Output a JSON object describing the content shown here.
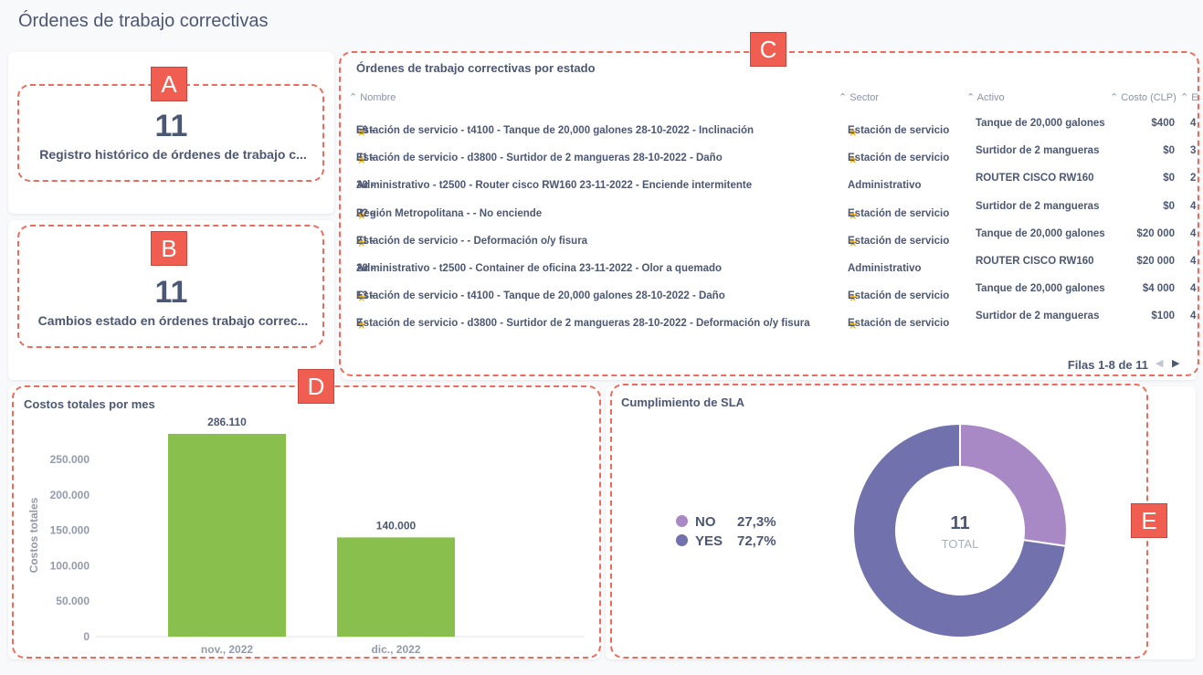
{
  "page_title": "Órdenes de trabajo correctivas",
  "callouts": [
    "A",
    "B",
    "C",
    "D",
    "E"
  ],
  "card_a": {
    "value": "11",
    "label": "Registro histórico de órdenes de trabajo c..."
  },
  "card_b": {
    "value": "11",
    "label": "Cambios estado en órdenes trabajo correc..."
  },
  "table": {
    "title": "Órdenes de trabajo correctivas por estado",
    "columns": [
      "Nombre",
      "Sector",
      "Activo",
      "Costo (CLP)",
      "E"
    ],
    "rows": [
      {
        "nombre_pre": "50 - ",
        "star": true,
        "nombre": "Estación de servicio - t4100 - Tanque de 20,000 galones 28-10-2022 - Inclinación",
        "sector_star": true,
        "sector": "Estación de servicio",
        "activo": "Tanque de 20,000 galones",
        "costo": "$400",
        "e": "4"
      },
      {
        "nombre_pre": "31 - ",
        "star": true,
        "nombre": "Estación de servicio - d3800 - Surtidor de 2 mangueras 28-10-2022 - Daño",
        "sector_star": true,
        "sector": "Estación de servicio",
        "activo": "Surtidor de 2 mangueras",
        "costo": "$0",
        "e": "3"
      },
      {
        "nombre_pre": "30 - ",
        "star": false,
        "nombre": "Administrativo - t2500 - Router cisco RW160 23-11-2022 - Enciende intermitente",
        "sector_star": false,
        "sector": "Administrativo",
        "activo": "ROUTER CISCO RW160",
        "costo": "$0",
        "e": "2"
      },
      {
        "nombre_pre": "22 - ",
        "star": true,
        "nombre": "Región Metropolitana - - No enciende",
        "sector_star": true,
        "sector": "Estación de servicio",
        "activo": "Surtidor de 2 mangueras",
        "costo": "$0",
        "e": "4"
      },
      {
        "nombre_pre": "21 - ",
        "star": true,
        "nombre": "Estación de servicio - - Deformación o/y fisura",
        "sector_star": true,
        "sector": "Estación de servicio",
        "activo": "Tanque de 20,000 galones",
        "costo": "$20 000",
        "e": "4"
      },
      {
        "nombre_pre": "20 - ",
        "star": false,
        "nombre": "Administrativo - t2500 - Container de oficina 23-11-2022 - Olor a quemado",
        "sector_star": false,
        "sector": "Administrativo",
        "activo": "ROUTER CISCO RW160",
        "costo": "$20 000",
        "e": "4"
      },
      {
        "nombre_pre": "13 - ",
        "star": true,
        "nombre": "Estación de servicio - t4100 - Tanque de 20,000 galones 28-10-2022 - Daño",
        "sector_star": true,
        "sector": "Estación de servicio",
        "activo": "Tanque de 20,000 galones",
        "costo": "$4 000",
        "e": "4"
      },
      {
        "nombre_pre": "7 - ",
        "star": true,
        "nombre": "Estación de servicio - d3800 - Surtidor de 2 mangueras 28-10-2022 - Deformación o/y fisura",
        "sector_star": true,
        "sector": "Estación de servicio",
        "activo": "Surtidor de 2 mangueras",
        "costo": "$100",
        "e": "4"
      }
    ],
    "footer": "Filas 1-8 de 11"
  },
  "chart_data": [
    {
      "type": "bar",
      "title": "Costos totales por mes",
      "ylabel": "Costos totales",
      "categories": [
        "nov., 2022",
        "dic., 2022"
      ],
      "values": [
        286110,
        140000
      ],
      "value_labels": [
        "286.110",
        "140.000"
      ],
      "yticks": [
        "0",
        "50.000",
        "100.000",
        "150.000",
        "200.000",
        "250.000"
      ],
      "ylim": [
        0,
        300000
      ],
      "color": "#88bf4d"
    },
    {
      "type": "pie",
      "title": "Cumplimiento de SLA",
      "labels": [
        "NO",
        "YES"
      ],
      "percent_labels": [
        "27,3%",
        "72,7%"
      ],
      "values": [
        27.3,
        72.7
      ],
      "colors": [
        "#a989c5",
        "#7172ad"
      ],
      "center_value": "11",
      "center_label": "TOTAL"
    }
  ]
}
